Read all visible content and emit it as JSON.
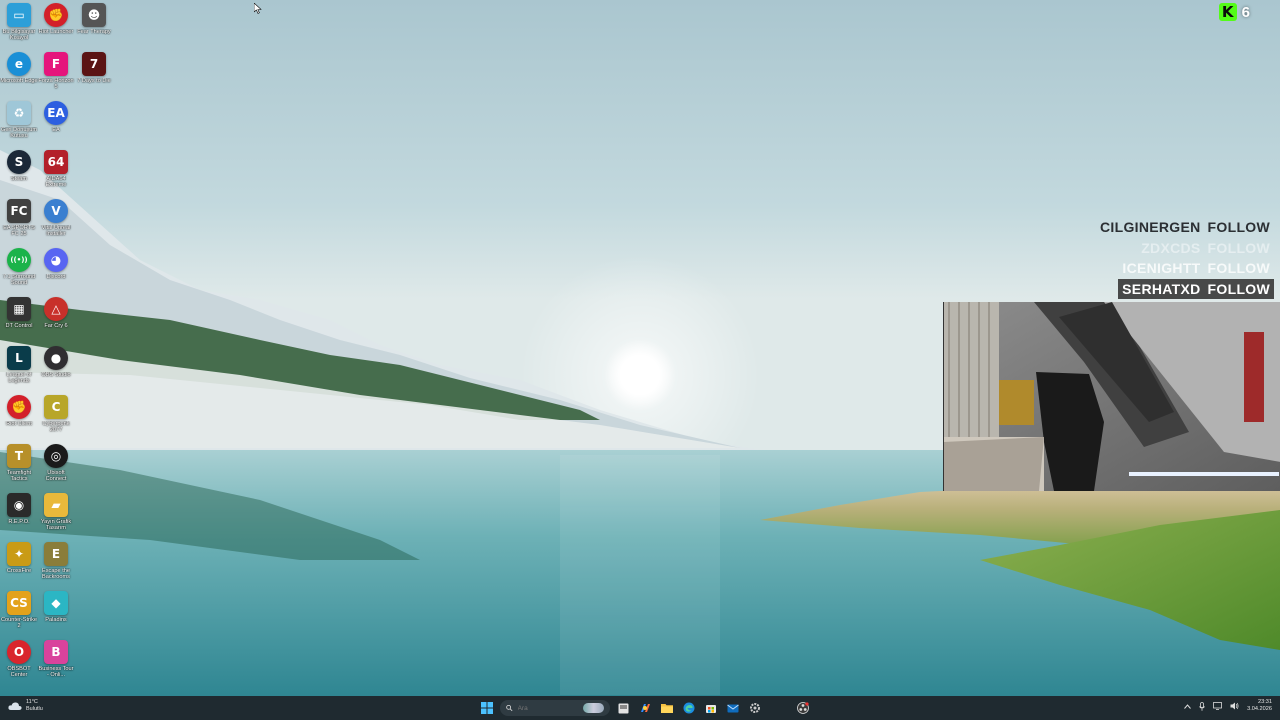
{
  "desktop": {
    "icons": [
      {
        "label": "Bu Bilgisayar Kısayol",
        "glyph": "▭",
        "color": "#2c9fd8",
        "name": "this-pc-icon"
      },
      {
        "label": "Riot Launcher",
        "glyph": "✊",
        "color": "#d3202a",
        "name": "riot-launcher-icon"
      },
      {
        "label": "Fear Therapy",
        "glyph": "☻",
        "color": "#555555",
        "name": "fear-therapy-icon"
      },
      {
        "label": "Microsoft Edge",
        "glyph": "e",
        "color": "#1a8fd6",
        "name": "edge-icon"
      },
      {
        "label": "Forza Horizon 5",
        "glyph": "F",
        "color": "#e5157c",
        "name": "forza-icon"
      },
      {
        "label": "7 Days to Die",
        "glyph": "7",
        "color": "#5b1414",
        "name": "seven-days-icon"
      },
      {
        "label": "Geri Dönüşüm Kutusu",
        "glyph": "♻",
        "color": "#9fc7d8",
        "name": "recycle-bin-icon"
      },
      {
        "label": "EA",
        "glyph": "EA",
        "color": "#2d5fe0",
        "name": "ea-icon"
      },
      {
        "label": "Steam",
        "glyph": "S",
        "color": "#1b2838",
        "name": "steam-icon"
      },
      {
        "label": "AIDA64 Extreme",
        "glyph": "64",
        "color": "#b3202a",
        "name": "aida64-icon"
      },
      {
        "label": "EA SPORTS FC 25",
        "glyph": "FC",
        "color": "#404040",
        "name": "ea-fc-icon"
      },
      {
        "label": "Vital Unreal Installer",
        "glyph": "V",
        "color": "#3a7fd0",
        "name": "vital-icon"
      },
      {
        "label": "7.1 Surround Sound",
        "glyph": "((•))",
        "color": "#1bb34a",
        "name": "surround-sound-icon"
      },
      {
        "label": "Discord",
        "glyph": "◕",
        "color": "#5865f2",
        "name": "discord-icon"
      },
      {
        "label": "DT Control",
        "glyph": "▦",
        "color": "#333333",
        "name": "dt-control-icon"
      },
      {
        "label": "Far Cry 6",
        "glyph": "△",
        "color": "#c8302a",
        "name": "far-cry-icon"
      },
      {
        "label": "League of Legends",
        "glyph": "L",
        "color": "#0a3c4a",
        "name": "league-icon"
      },
      {
        "label": "OBS Studio",
        "glyph": "●",
        "color": "#302e31",
        "name": "obs-icon"
      },
      {
        "label": "Riot Client",
        "glyph": "✊",
        "color": "#d3202a",
        "name": "riot-client-icon"
      },
      {
        "label": "Cyberpunk 2077",
        "glyph": "C",
        "color": "#b8a629",
        "name": "cyberpunk-icon"
      },
      {
        "label": "Teamfight Tactics",
        "glyph": "T",
        "color": "#b7902a",
        "name": "tft-icon"
      },
      {
        "label": "Ubisoft Connect",
        "glyph": "◎",
        "color": "#1a1a1a",
        "name": "ubisoft-icon"
      },
      {
        "label": "R.E.P.O.",
        "glyph": "◉",
        "color": "#2a2a2a",
        "name": "repo-icon"
      },
      {
        "label": "Yayın Grafik Tasarım",
        "glyph": "▰",
        "color": "#e9b93b",
        "name": "folder-icon"
      },
      {
        "label": "CrossFire",
        "glyph": "✦",
        "color": "#c99b16",
        "name": "crossfire-icon"
      },
      {
        "label": "Escape the Backrooms",
        "glyph": "E",
        "color": "#8a7d3a",
        "name": "backrooms-icon"
      },
      {
        "label": "Counter-Strike 2",
        "glyph": "CS",
        "color": "#e3a21b",
        "name": "cs2-icon"
      },
      {
        "label": "Paladins",
        "glyph": "◆",
        "color": "#2bb6c4",
        "name": "paladins-icon"
      },
      {
        "label": "OBSBOT Center",
        "glyph": "O",
        "color": "#d9252d",
        "name": "obsbot-icon"
      },
      {
        "label": "Business Tour - Onli...",
        "glyph": "B",
        "color": "#d9439c",
        "name": "business-tour-icon"
      }
    ]
  },
  "overlay": {
    "kick_logo": "K",
    "viewer_count": "6",
    "follows": [
      {
        "user": "CILGINERGEN",
        "action": "FOLLOW"
      },
      {
        "user": "ZDXCDS",
        "action": "FOLLOW"
      },
      {
        "user": "ICENIGHTT",
        "action": "FOLLOW"
      },
      {
        "user": "SERHATXD",
        "action": "FOLLOW"
      }
    ]
  },
  "taskbar": {
    "weather_temp": "11°C",
    "weather_desc": "Bulutlu",
    "search_placeholder": "Ara",
    "clock_time": "23:31",
    "clock_date": "3.04.2026"
  }
}
